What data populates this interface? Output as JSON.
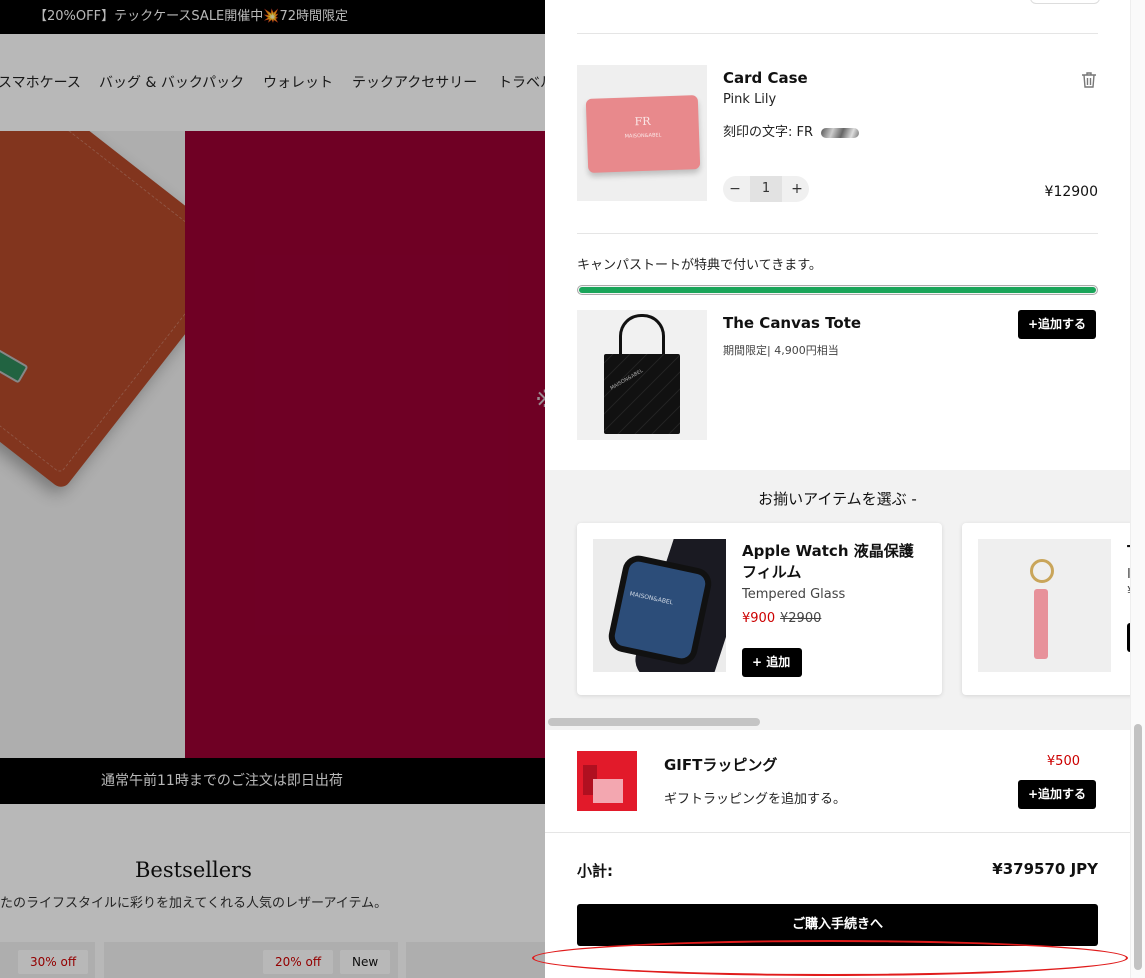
{
  "background_page": {
    "announcement": "【20%OFF】テックケースSALE開催中💥72時間限定",
    "nav": [
      "スマホケース",
      "バッグ & バックパック",
      "ウォレット",
      "テックアクセサリー",
      "トラベル"
    ],
    "hero_mark": "※",
    "shipping_banner": "通常午前11時までのご注文は即日出荷",
    "bestsellers_title": "Bestsellers",
    "bestsellers_subtitle": "たのライフスタイルに彩りを加えてくれる人気のレザーアイテム。",
    "tags": [
      "30% off",
      "20% off",
      "New"
    ]
  },
  "cart": {
    "item": {
      "name": "Card Case",
      "color": "Pink Lily",
      "engraving": "刻印の文字: FR",
      "product_mark": "FR",
      "product_brand": "MAISON&ABEL",
      "quantity": "1",
      "price": "¥12900",
      "minus": "−",
      "plus": "+"
    },
    "free_gift": {
      "message": "キャンパストートが特典で付いてきます。",
      "progress_fraction": 1.0,
      "name": "The Canvas Tote",
      "subtitle": "期間限定| 4,900円相当",
      "add_label": "+追加する",
      "tote_print": "MAISON&ABEL"
    },
    "upsell": {
      "title": "お揃いアイテムを選ぶ  -",
      "cards": [
        {
          "name": "Apple Watch 液晶保護フィルム",
          "subtitle": "Tempered Glass",
          "sale_price": "¥900",
          "orig_price": "¥2900",
          "add_label": "+ 追加",
          "image_text": "MAISON&ABEL"
        },
        {
          "name": "T",
          "subtitle": "I",
          "price": "¥",
          "add_label": ""
        }
      ]
    },
    "gift_wrap": {
      "title": "GIFTラッピング",
      "description": "ギフトラッピングを追加する。",
      "price": "¥500",
      "add_label": "+追加する"
    },
    "subtotal_label": "小計:",
    "subtotal_value": "¥379570 JPY",
    "checkout_label": "ご購入手続きへ"
  },
  "colors": {
    "accent_red": "#9a0033",
    "progress_green": "#1aa55a",
    "annotation": "#e01b1b"
  }
}
